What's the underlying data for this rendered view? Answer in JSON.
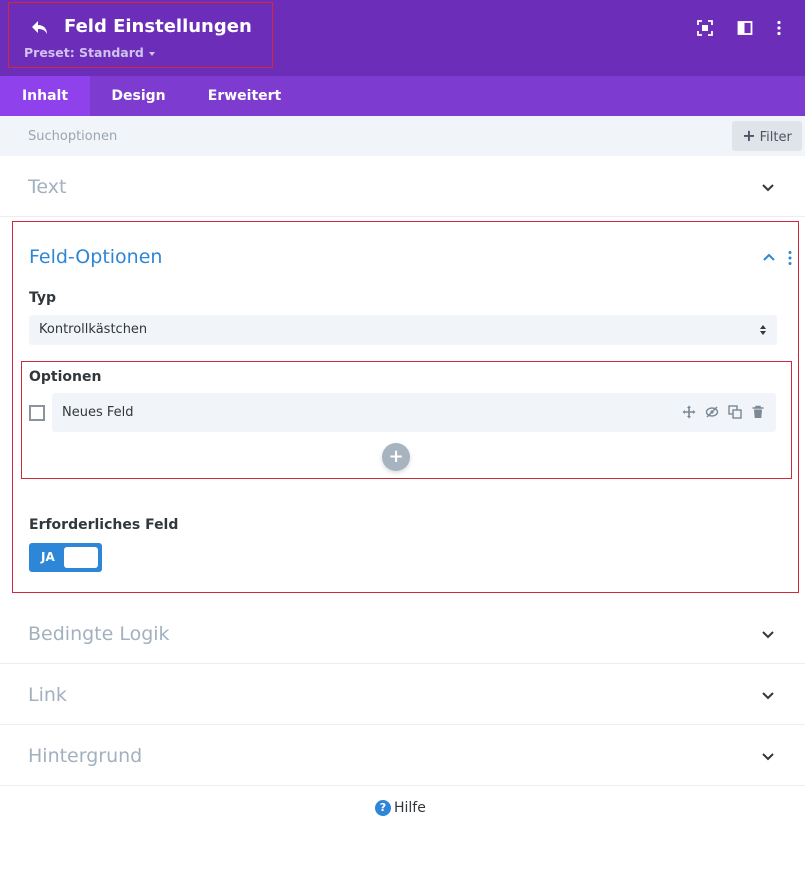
{
  "header": {
    "title": "Feld Einstellungen",
    "preset": "Preset: Standard",
    "icons": [
      "back-icon",
      "focus-icon",
      "sidebar-layout-icon",
      "more-vertical-icon"
    ]
  },
  "tabs": [
    {
      "label": "Inhalt",
      "active": true
    },
    {
      "label": "Design",
      "active": false
    },
    {
      "label": "Erweitert",
      "active": false
    }
  ],
  "search": {
    "placeholder": "Suchoptionen",
    "filter_label": "Filter"
  },
  "sections": {
    "text": "Text",
    "field_options": {
      "title": "Feld-Optionen",
      "type_label": "Typ",
      "type_value": "Kontrollkästchen",
      "options_label": "Optionen",
      "option_items": [
        "Neues Feld"
      ],
      "add_symbol": "+",
      "required_label": "Erforderliches Feld",
      "required_toggle": "JA"
    },
    "conditional_logic": "Bedingte Logik",
    "link": "Link",
    "background": "Hintergrund"
  },
  "footer": {
    "help_symbol": "?",
    "help_label": "Hilfe"
  },
  "colors": {
    "header_bg": "#6c2eb9",
    "tabs_bg": "#7e3bd0",
    "active_tab_bg": "#8f42ec",
    "accent_blue": "#2e86d6",
    "highlight_red": "#d0293c"
  }
}
